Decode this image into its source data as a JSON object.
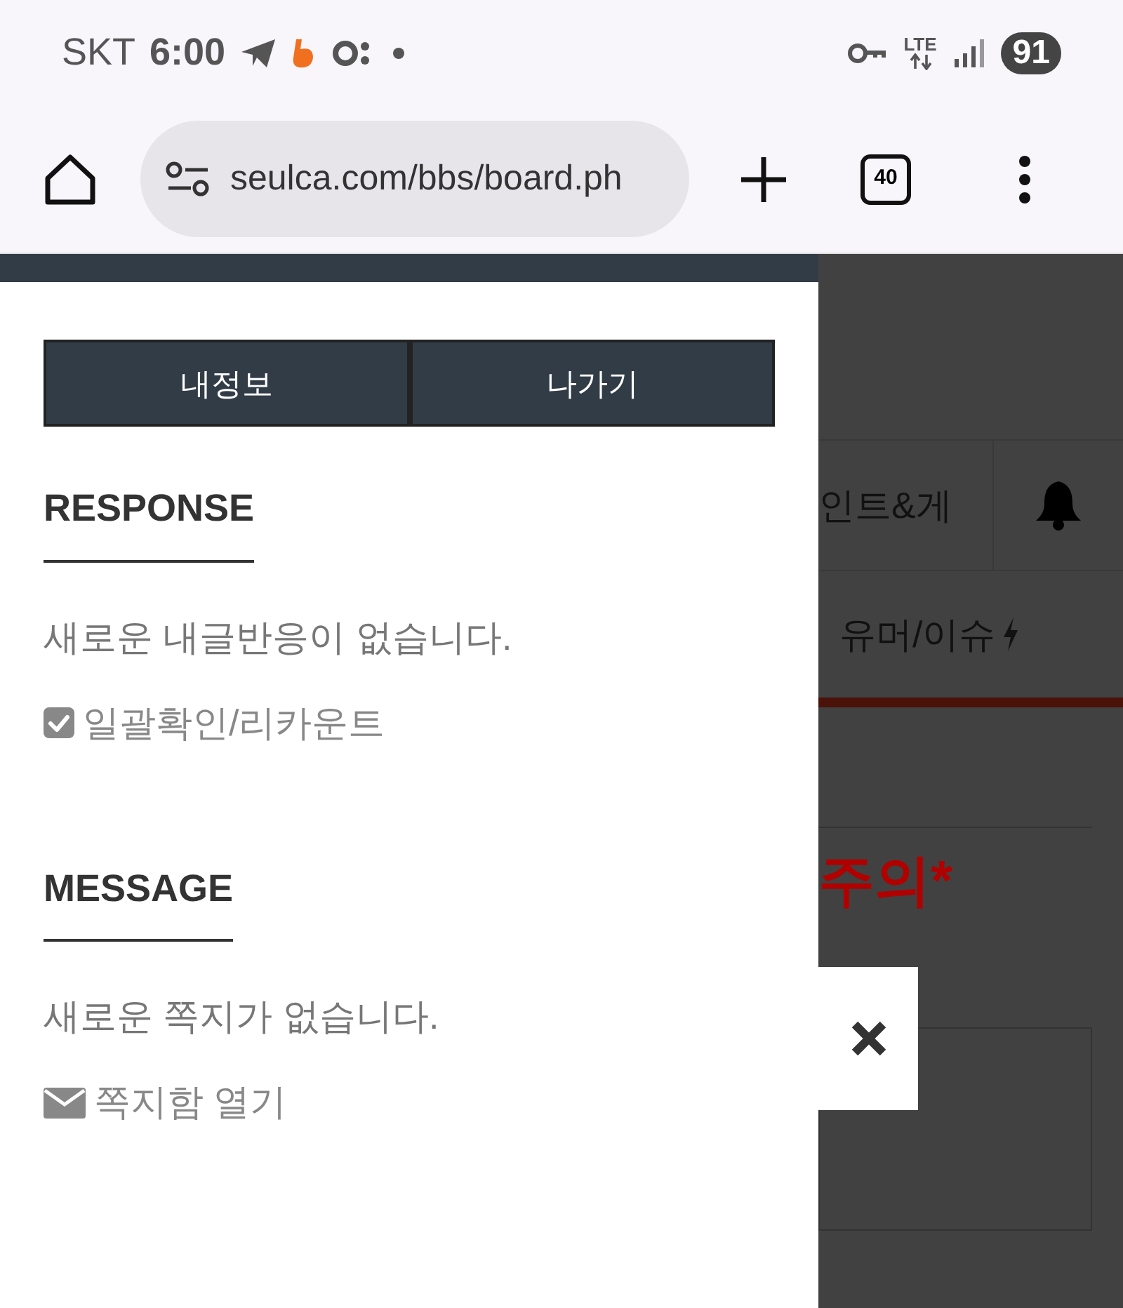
{
  "status_bar": {
    "carrier": "SKT",
    "time": "6:00",
    "network": "LTE",
    "battery": "91"
  },
  "browser": {
    "url": "seulca.com/bbs/board.ph",
    "tab_count": "40"
  },
  "drawer": {
    "buttons": [
      "내정보",
      "나가기"
    ],
    "sections": [
      {
        "title": "RESPONSE",
        "message": "새로운 내글반응이 없습니다.",
        "action": {
          "kind": "check",
          "label": "일괄확인/리카운트"
        }
      },
      {
        "title": "MESSAGE",
        "message": "새로운 쪽지가 없습니다.",
        "action": {
          "kind": "mail",
          "label": "쪽지함 열기"
        }
      }
    ]
  },
  "background_page": {
    "nav_items": [
      "인트&게",
      "유머/이슈"
    ],
    "heading": "주의*"
  }
}
